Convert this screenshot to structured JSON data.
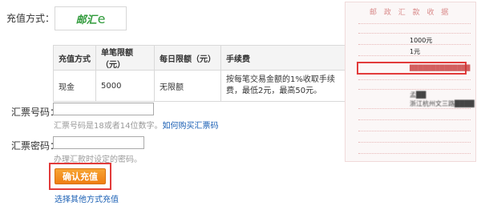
{
  "recharge_method": {
    "label": "充值方式：",
    "logo_text": "邮汇",
    "logo_mark": "e"
  },
  "fee_table": {
    "headers": [
      "充值方式",
      "单笔限额（元）",
      "每日限额（元）",
      "手续费"
    ],
    "row": [
      "现金",
      "5000",
      "无限额",
      "按每笔交易金额的1%收取手续费，最低2元，最高50元。"
    ]
  },
  "money_order_number": {
    "label": "汇票号码：",
    "value": "",
    "hint": "汇票号码是18或者14位数字。",
    "hint_link": "如何购买汇票码"
  },
  "money_order_password": {
    "label": "汇票密码：",
    "value": "",
    "hint": "办理汇款时设定的密码。"
  },
  "actions": {
    "confirm_button": "确认充值",
    "other_method_link": "选择其他方式充值"
  },
  "receipt": {
    "title": "邮 政 汇 款 收 据",
    "amount_value": "1000元",
    "fee_value": "1元",
    "id_masked": "██████████████",
    "recipient_value": "孟██",
    "address_value": "浙江杭州文三路████"
  },
  "colors": {
    "accent_orange": "#f08c1a",
    "highlight_red": "#e23b3b",
    "link_blue": "#1a5fb4",
    "logo_green": "#2f9a3a"
  }
}
